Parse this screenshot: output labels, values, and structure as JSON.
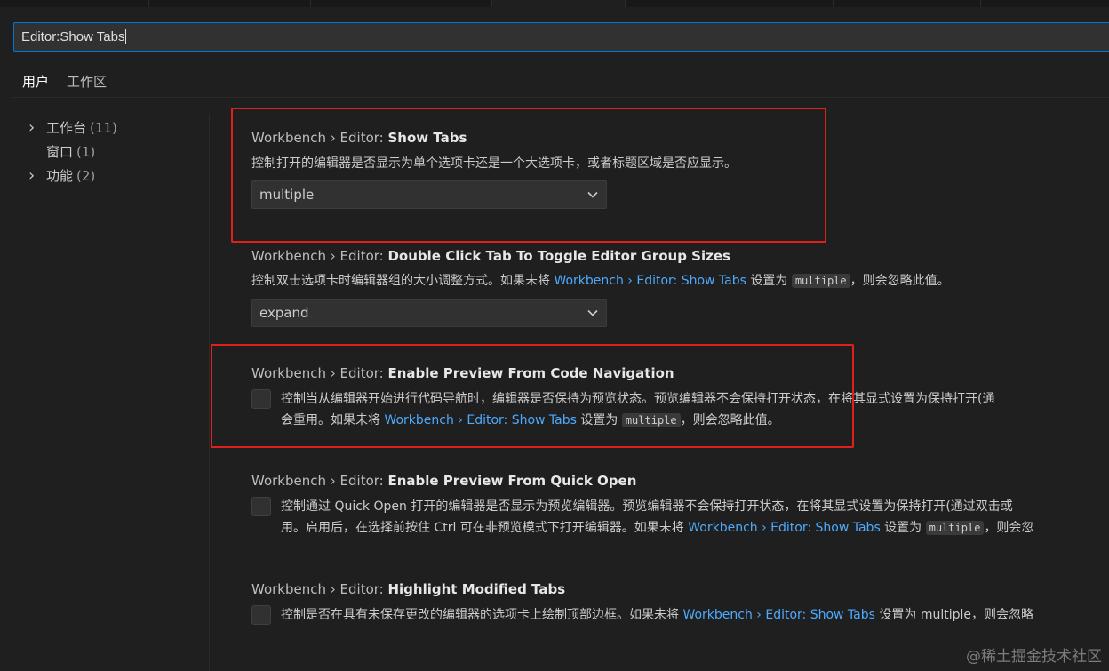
{
  "search": {
    "value": "Editor:Show Tabs"
  },
  "scope_tabs": [
    {
      "label": "用户"
    },
    {
      "label": "工作区"
    }
  ],
  "toc": [
    {
      "label": "工作台",
      "count": "(11)"
    },
    {
      "label": "窗口",
      "count": "(1)"
    },
    {
      "label": "功能",
      "count": "(2)"
    }
  ],
  "settings": [
    {
      "category": "Workbench › Editor: ",
      "key": "Show Tabs",
      "description": "控制打开的编辑器是否显示为单个选项卡还是一个大选项卡，或者标题区域是否应显示。",
      "value": "multiple"
    },
    {
      "category": "Workbench › Editor: ",
      "key": "Double Click Tab To Toggle Editor Group Sizes",
      "desc_before": "控制双击选项卡时编辑器组的大小调整方式。如果未将 ",
      "desc_link": "Workbench › Editor: Show Tabs",
      "desc_mid": " 设置为 ",
      "desc_code": "multiple",
      "desc_after": "，则会忽略此值。",
      "value": "expand"
    },
    {
      "category": "Workbench › Editor: ",
      "key": "Enable Preview From Code Navigation",
      "desc_line1": "控制当从编辑器开始进行代码导航时，编辑器是否保持为预览状态。预览编辑器不会保持打开状态，在将其显式设置为保持打开(通",
      "desc_line2_before": "会重用。如果未将 ",
      "desc_link": "Workbench › Editor: Show Tabs",
      "desc_mid": " 设置为 ",
      "desc_code": "multiple",
      "desc_after": "，则会忽略此值。"
    },
    {
      "category": "Workbench › Editor: ",
      "key": "Enable Preview From Quick Open",
      "desc_line1": "控制通过 Quick Open 打开的编辑器是否显示为预览编辑器。预览编辑器不会保持打开状态，在将其显式设置为保持打开(通过双击或",
      "desc_line2_before": "用。启用后，在选择前按住 Ctrl 可在非预览模式下打开编辑器。如果未将 ",
      "desc_link": "Workbench › Editor: Show Tabs",
      "desc_mid": " 设置为 ",
      "desc_code": "multiple",
      "desc_after": "，则会忽"
    },
    {
      "category": "Workbench › Editor: ",
      "key": "Highlight Modified Tabs",
      "desc_before": "控制是否在具有未保存更改的编辑器的选项卡上绘制顶部边框。如果未将 ",
      "desc_link": "Workbench › Editor: Show Tabs",
      "desc_after": " 设置为 multiple，则会忽略"
    }
  ],
  "watermark": "@稀土掘金技术社区",
  "colors": {
    "accent": "#0078d4",
    "link": "#4daafc",
    "highlight_box": "#e01f1f",
    "background": "#1f1f1f"
  },
  "icons": {
    "chevron_right": "chevron-right-icon",
    "chevron_down": "chevron-down-icon"
  }
}
